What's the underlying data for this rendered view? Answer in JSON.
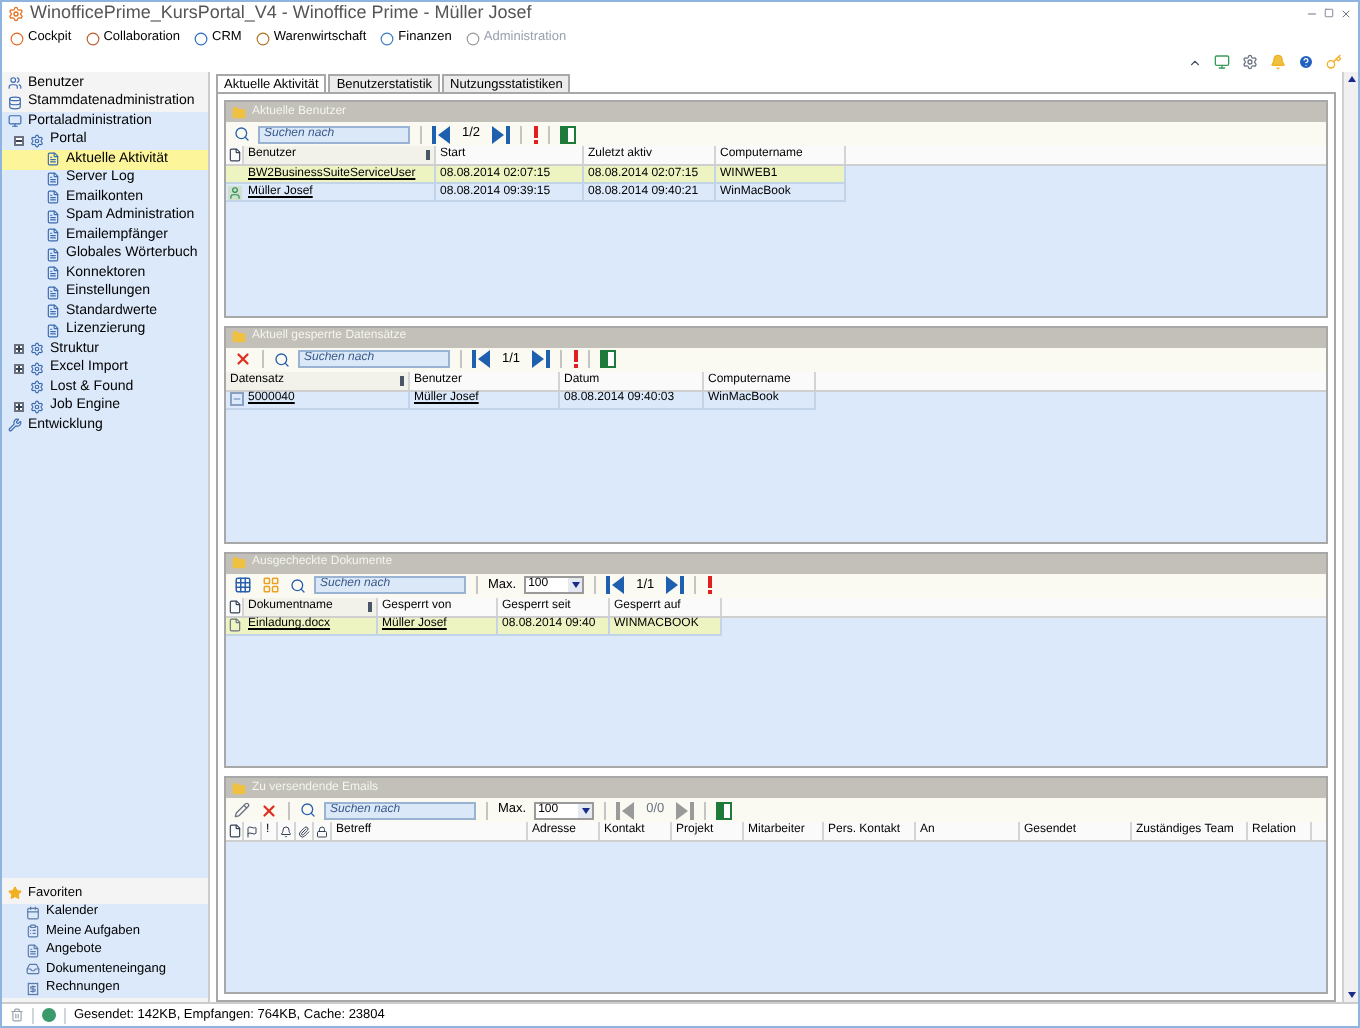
{
  "window": {
    "title": "WinofficePrime_KursPortal_V4 - Winoffice Prime - Müller Josef"
  },
  "menu": [
    {
      "label": "Cockpit",
      "disabled": false
    },
    {
      "label": "Collaboration",
      "disabled": false
    },
    {
      "label": "CRM",
      "disabled": false
    },
    {
      "label": "Warenwirtschaft",
      "disabled": false
    },
    {
      "label": "Finanzen",
      "disabled": false
    },
    {
      "label": "Administration",
      "disabled": true
    }
  ],
  "sidebar": {
    "items": [
      {
        "label": "Benutzer",
        "selected": false
      },
      {
        "label": "Stammdatenadministration",
        "selected": false
      },
      {
        "label": "Portaladministration",
        "selected": false,
        "children": [
          {
            "label": "Portal",
            "selected": false,
            "expanded": true,
            "children": [
              {
                "label": "Aktuelle Aktivität",
                "selected": true
              },
              {
                "label": "Server Log",
                "selected": false
              },
              {
                "label": "Emailkonten",
                "selected": false
              },
              {
                "label": "Spam Administration",
                "selected": false
              },
              {
                "label": "Emailempfänger",
                "selected": false
              },
              {
                "label": "Globales Wörterbuch",
                "selected": false
              },
              {
                "label": "Konnektoren",
                "selected": false
              },
              {
                "label": "Einstellungen",
                "selected": false
              },
              {
                "label": "Standardwerte",
                "selected": false
              },
              {
                "label": "Lizenzierung",
                "selected": false
              }
            ]
          },
          {
            "label": "Struktur",
            "selected": false,
            "expanded": false
          },
          {
            "label": "Excel Import",
            "selected": false,
            "expanded": false
          },
          {
            "label": "Lost & Found",
            "selected": false
          },
          {
            "label": "Job Engine",
            "selected": false,
            "expanded": false
          }
        ]
      },
      {
        "label": "Entwicklung",
        "selected": false
      }
    ]
  },
  "favorites": {
    "title": "Favoriten",
    "items": [
      "Kalender",
      "Meine Aufgaben",
      "Angebote",
      "Dokumenteneingang",
      "Rechnungen"
    ]
  },
  "tabs": [
    {
      "label": "Aktuelle Aktivität",
      "selected": true
    },
    {
      "label": "Benutzerstatistik",
      "selected": false
    },
    {
      "label": "Nutzungsstatistiken",
      "selected": false
    }
  ],
  "panels": [
    {
      "title": "Aktuelle Benutzer",
      "toolbar": [
        {
          "kind": "search",
          "placeholder": "Suchen nach"
        },
        {
          "kind": "separator"
        },
        {
          "kind": "pager",
          "page": "1/2",
          "disabled": false
        },
        {
          "kind": "separator"
        },
        {
          "kind": "alert"
        },
        {
          "kind": "separator"
        },
        {
          "kind": "excel"
        }
      ],
      "columns": [
        {
          "label": "Benutzer",
          "sorted": true
        },
        {
          "label": "Start",
          "sorted": false
        },
        {
          "label": "Zuletzt aktiv",
          "sorted": false
        },
        {
          "label": "Computername",
          "sorted": false
        }
      ],
      "rows": [
        {
          "kind": "plain",
          "selected": true,
          "cells": [
            "BW2BusinessSuiteServiceUser",
            "08.08.2014 02:07:15",
            "08.08.2014 02:07:15",
            "WINWEB1"
          ]
        },
        {
          "kind": "user",
          "selected": false,
          "cells": [
            "Müller Josef",
            "08.08.2014 09:39:15",
            "08.08.2014 09:40:21",
            "WinMacBook"
          ]
        }
      ]
    },
    {
      "title": "Aktuell gesperrte Datensätze",
      "toolbar": [
        {
          "kind": "delete"
        },
        {
          "kind": "separator"
        },
        {
          "kind": "search",
          "placeholder": "Suchen nach"
        },
        {
          "kind": "separator"
        },
        {
          "kind": "pager",
          "page": "1/1",
          "disabled": false
        },
        {
          "kind": "separator"
        },
        {
          "kind": "alert"
        },
        {
          "kind": "separator"
        },
        {
          "kind": "excel"
        }
      ],
      "columns": [
        {
          "label": "Datensatz",
          "sorted": true
        },
        {
          "label": "Benutzer",
          "sorted": false
        },
        {
          "label": "Datum",
          "sorted": false
        },
        {
          "label": "Computername",
          "sorted": false
        }
      ],
      "rows": [
        {
          "kind": "record",
          "selected": false,
          "cells": [
            "5000040",
            "Müller Josef",
            "08.08.2014 09:40:03",
            "WinMacBook"
          ]
        }
      ]
    },
    {
      "title": "Ausgecheckte Dokumente",
      "toolbar": [
        {
          "kind": "grid-view"
        },
        {
          "kind": "tile-view"
        },
        {
          "kind": "search",
          "placeholder": "Suchen nach"
        },
        {
          "kind": "separator"
        },
        {
          "kind": "max",
          "label": "Max.",
          "value": "100"
        },
        {
          "kind": "separator"
        },
        {
          "kind": "pager",
          "page": "1/1",
          "disabled": false
        },
        {
          "kind": "separator"
        },
        {
          "kind": "alert"
        }
      ],
      "columns": [
        {
          "label": "Dokumentname",
          "sorted": true
        },
        {
          "label": "Gesperrt von",
          "sorted": false
        },
        {
          "label": "Gesperrt seit",
          "sorted": false
        },
        {
          "label": "Gesperrt auf",
          "sorted": false
        }
      ],
      "rows": [
        {
          "kind": "document",
          "selected": true,
          "cells": [
            "Einladung.docx",
            "Müller Josef",
            "08.08.2014 09:40",
            "WINMACBOOK"
          ]
        }
      ]
    },
    {
      "title": "Zu versendende Emails",
      "toolbar": [
        {
          "kind": "edit"
        },
        {
          "kind": "delete"
        },
        {
          "kind": "separator"
        },
        {
          "kind": "search",
          "placeholder": "Suchen nach"
        },
        {
          "kind": "separator"
        },
        {
          "kind": "max",
          "label": "Max.",
          "value": "100"
        },
        {
          "kind": "separator"
        },
        {
          "kind": "pager",
          "page": "0/0",
          "disabled": true
        },
        {
          "kind": "separator"
        },
        {
          "kind": "excel"
        }
      ],
      "columns": [
        {
          "label": "!",
          "sorted": false
        },
        {
          "label": "Betreff",
          "sorted": false
        },
        {
          "label": "Adresse",
          "sorted": false
        },
        {
          "label": "Kontakt",
          "sorted": false
        },
        {
          "label": "Projekt",
          "sorted": false
        },
        {
          "label": "Mitarbeiter",
          "sorted": false
        },
        {
          "label": "Pers. Kontakt",
          "sorted": false
        },
        {
          "label": "An",
          "sorted": false
        },
        {
          "label": "Gesendet",
          "sorted": false
        },
        {
          "label": "Zuständiges Team",
          "sorted": false
        },
        {
          "label": "Relation",
          "sorted": false
        }
      ]
    }
  ],
  "status_bar": {
    "text": "Gesendet: 142KB, Empfangen: 764KB, Cache: 23804"
  }
}
